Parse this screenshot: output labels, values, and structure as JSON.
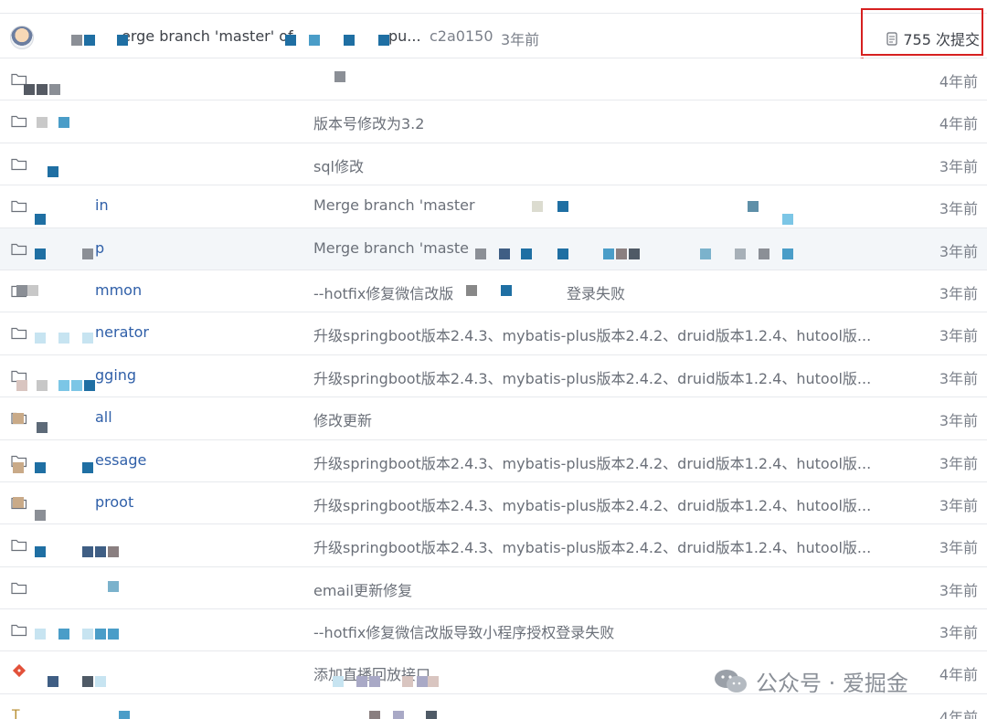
{
  "commit_bar": {
    "message": "erge branch 'master' of",
    "ellipsis": "pu...",
    "hash": "c2a0150",
    "age": "3年前",
    "count_label": "755 次提交"
  },
  "files": [
    {
      "name": "",
      "message": "",
      "age": "4年前",
      "icon": "folder-icon"
    },
    {
      "name": "",
      "message": "版本号修改为3.2",
      "age": "4年前",
      "icon": "folder-icon"
    },
    {
      "name": "",
      "message": "sql修改",
      "age": "3年前",
      "icon": "folder-icon"
    },
    {
      "name": "in",
      "message": "Merge branch 'master",
      "age": "3年前",
      "icon": "folder-icon"
    },
    {
      "name": "p",
      "message": "Merge branch 'maste",
      "age": "3年前",
      "icon": "folder-icon"
    },
    {
      "name": "mmon",
      "message": "--hotfix修复微信改版",
      "age": "3年前",
      "icon": "folder-icon"
    },
    {
      "name": "nerator",
      "message": "升级springboot版本2.4.3、mybatis-plus版本2.4.2、druid版本1.2.4、hutool版...",
      "age": "3年前",
      "icon": "folder-icon"
    },
    {
      "name": "gging",
      "message": "升级springboot版本2.4.3、mybatis-plus版本2.4.2、druid版本1.2.4、hutool版...",
      "age": "3年前",
      "icon": "folder-icon"
    },
    {
      "name": "all",
      "message": "修改更新",
      "age": "3年前",
      "icon": "folder-icon"
    },
    {
      "name": "essage",
      "message": "升级springboot版本2.4.3、mybatis-plus版本2.4.2、druid版本1.2.4、hutool版...",
      "age": "3年前",
      "icon": "folder-icon"
    },
    {
      "name": "proot",
      "message": "升级springboot版本2.4.3、mybatis-plus版本2.4.2、druid版本1.2.4、hutool版...",
      "age": "3年前",
      "icon": "folder-icon"
    },
    {
      "name": "",
      "message": "升级springboot版本2.4.3、mybatis-plus版本2.4.2、druid版本1.2.4、hutool版...",
      "age": "3年前",
      "icon": "folder-icon"
    },
    {
      "name": "",
      "message": "email更新修复",
      "age": "3年前",
      "icon": "folder-icon"
    },
    {
      "name": "",
      "message": "--hotfix修复微信改版导致小程序授权登录失败",
      "age": "3年前",
      "icon": "folder-icon"
    },
    {
      "name": "",
      "message": "添加直播回放接口",
      "age": "4年前",
      "icon": "git-icon"
    },
    {
      "name": "",
      "message": "",
      "age": "4年前",
      "icon": "text-file-icon"
    }
  ],
  "row6_suffix": "登录失败",
  "watermark": {
    "text": "公众号 · 爱掘金",
    "icon": "wechat-icon"
  },
  "colors": {
    "annotation": "#d62020",
    "pixel_blue": "#1f6fa3",
    "pixel_gray": "#8b8f96"
  }
}
